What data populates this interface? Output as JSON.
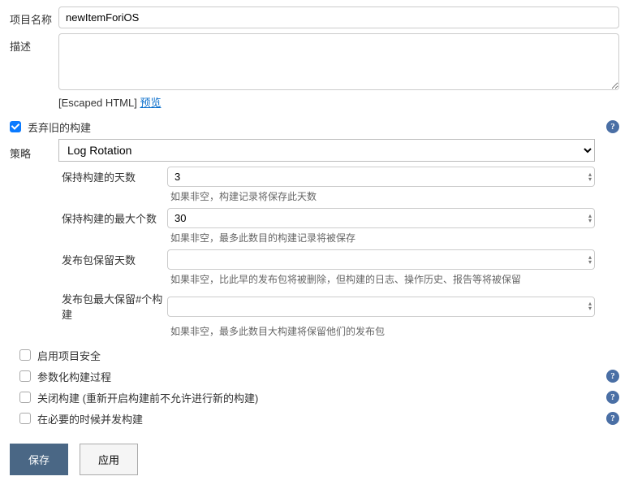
{
  "project_name": {
    "label": "项目名称",
    "value": "newItemForiOS"
  },
  "description": {
    "label": "描述",
    "value": "",
    "escaped_label": "[Escaped HTML] ",
    "preview_link": "预览"
  },
  "discard_old": {
    "label": "丢弃旧的构建",
    "checked": true
  },
  "policy": {
    "label": "策略",
    "selected": "Log Rotation"
  },
  "log_rotation": {
    "days": {
      "label": "保持构建的天数",
      "value": "3",
      "hint": "如果非空，构建记录将保存此天数"
    },
    "max": {
      "label": "保持构建的最大个数",
      "value": "30",
      "hint": "如果非空，最多此数目的构建记录将被保存"
    },
    "artifact_days": {
      "label": "发布包保留天数",
      "value": "",
      "hint": "如果非空，比此早的发布包将被删除，但构建的日志、操作历史、报告等将被保留"
    },
    "artifact_max": {
      "label": "发布包最大保留#个构建",
      "value": "",
      "hint": "如果非空，最多此数目大构建将保留他们的发布包"
    }
  },
  "options": {
    "security": {
      "label": "启用项目安全",
      "checked": false,
      "help": false
    },
    "parametric": {
      "label": "参数化构建过程",
      "checked": false,
      "help": true
    },
    "disable": {
      "label": "关闭构建 (重新开启构建前不允许进行新的构建)",
      "checked": false,
      "help": true
    },
    "concurrent": {
      "label": "在必要的时候并发构建",
      "checked": false,
      "help": true
    }
  },
  "buttons": {
    "save": "保存",
    "apply": "应用"
  }
}
